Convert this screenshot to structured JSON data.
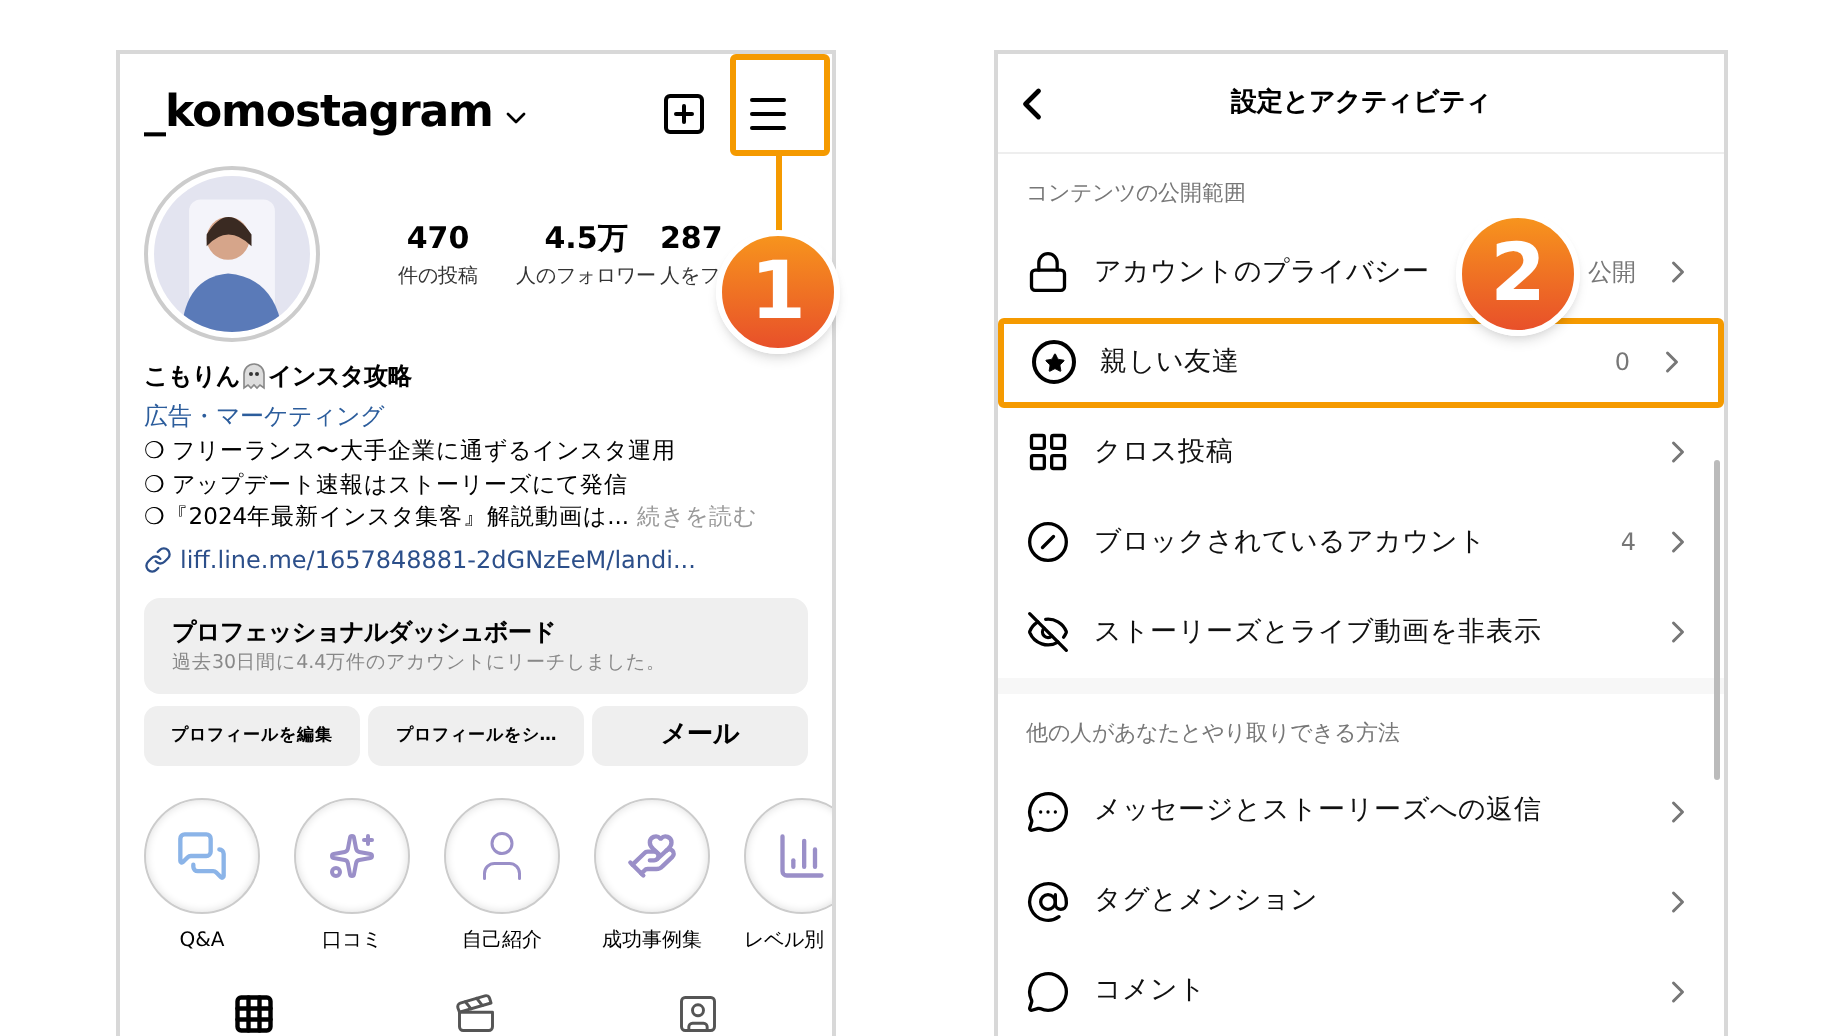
{
  "profile_screen": {
    "username": "_komostagram",
    "stats": [
      {
        "value": "470",
        "label": "件の投稿"
      },
      {
        "value": "4.5万",
        "label": "人のフォロワー"
      },
      {
        "value": "287",
        "label": "人をフ"
      }
    ],
    "name_before": "こもりん",
    "name_after": "インスタ攻略",
    "category": "広告・マーケティング",
    "bio": [
      "❍ フリーランス〜大手企業に通ずるインスタ運用",
      "❍ アップデート速報はストーリーズにて発信",
      "❍『2024年最新インスタ集客』解説動画は..."
    ],
    "more": "続きを読む",
    "link": "liff.line.me/1657848881-2dGNzEeM/landi...",
    "dashboard": {
      "title": "プロフェッショナルダッシュボード",
      "subtitle": "過去30日間に4.4万件のアカウントにリーチしました。"
    },
    "buttons": [
      {
        "label": "プロフィールを編集",
        "kind": "small"
      },
      {
        "label": "プロフィールをシ…",
        "kind": "small"
      },
      {
        "label": "メール",
        "kind": "large"
      }
    ],
    "highlights": [
      {
        "label": "Q&A",
        "kind": "qa"
      },
      {
        "label": "口コミ",
        "kind": "sparkle"
      },
      {
        "label": "自己紹介",
        "kind": "person"
      },
      {
        "label": "成功事例集",
        "kind": "hand"
      },
      {
        "label": "レベル別",
        "kind": "chart"
      }
    ],
    "tabs": [
      {
        "kind": "grid",
        "selected": true
      },
      {
        "kind": "reels",
        "selected": false
      },
      {
        "kind": "tagged",
        "selected": false
      }
    ]
  },
  "step_badges": [
    "1",
    "2"
  ],
  "settings_screen": {
    "title": "設定とアクティビティ",
    "sections": [
      {
        "header": "コンテンツの公開範囲",
        "rows": [
          {
            "kind": "lock",
            "label": "アカウントのプライバシー",
            "value": "公開",
            "highlighted": false
          },
          {
            "kind": "star",
            "label": "親しい友達",
            "value": "0",
            "highlighted": true
          },
          {
            "kind": "grid-plus",
            "label": "クロス投稿",
            "highlighted": false
          },
          {
            "kind": "block",
            "label": "ブロックされているアカウント",
            "value": "4",
            "highlighted": false
          },
          {
            "kind": "hide",
            "label": "ストーリーズとライブ動画を非表示",
            "highlighted": false
          }
        ]
      },
      {
        "header": "他の人があなたとやり取りできる方法",
        "rows": [
          {
            "kind": "messenger",
            "label": "メッセージとストーリーズへの返信",
            "highlighted": false
          },
          {
            "kind": "at",
            "label": "タグとメンション",
            "highlighted": false
          },
          {
            "kind": "comment",
            "label": "コメント",
            "highlighted": false
          }
        ]
      }
    ]
  }
}
